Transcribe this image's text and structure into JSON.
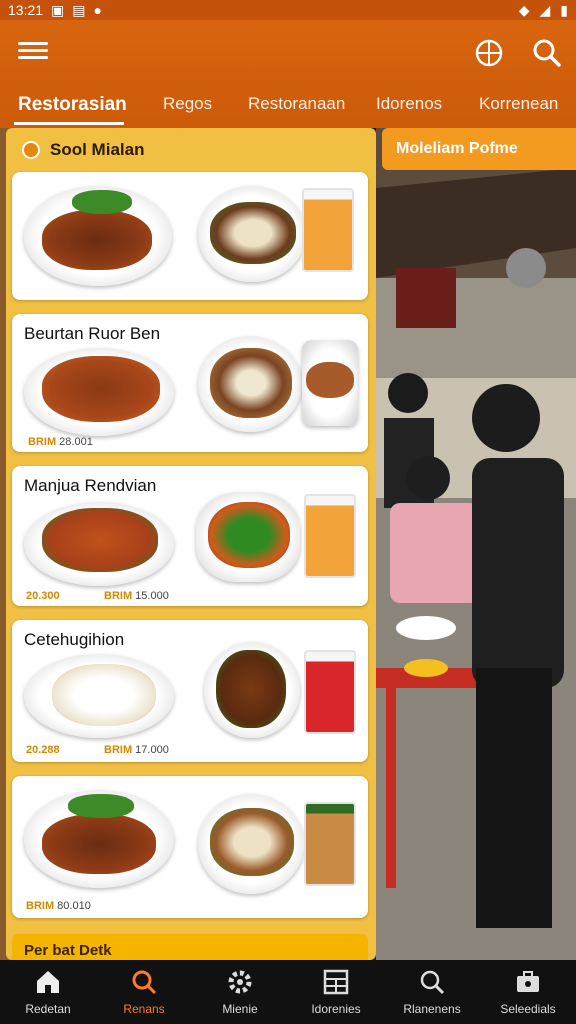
{
  "status_bar": {
    "time": "13:21"
  },
  "app_bar": {
    "tabs": [
      "Restorasian",
      "Regos",
      "Restoranaan",
      "Idorenos",
      "Korrenean"
    ],
    "active_tab": 0
  },
  "left_panel": {
    "header": "Sool Mialan",
    "cards": [
      {
        "title": "",
        "price_left_code": "",
        "price_left_value": "",
        "price_right_code": "",
        "price_right_value": ""
      },
      {
        "title": "Beurtan Ruor Ben",
        "price_left_code": "BRIM",
        "price_left_value": "28.001",
        "price_right_code": "",
        "price_right_value": ""
      },
      {
        "title": "Manjua Rendvian",
        "price_left_code": "20.300",
        "price_left_value": "",
        "price_right_code": "BRIM",
        "price_right_value": "15.000"
      },
      {
        "title": "Cetehugihion",
        "price_left_code": "20.288",
        "price_left_value": "",
        "price_right_code": "BRIM",
        "price_right_value": "17.000"
      },
      {
        "title": "",
        "price_left_code": "BRIM",
        "price_left_value": "80.010",
        "price_right_code": "",
        "price_right_value": ""
      }
    ],
    "bottom_label": "Per bat Detk"
  },
  "right_panel": {
    "header": "Moleliam Pofme"
  },
  "bottom_nav": [
    {
      "label": "Redetan",
      "icon": "home-icon"
    },
    {
      "label": "Renans",
      "icon": "search-icon"
    },
    {
      "label": "Mienie",
      "icon": "gear-icon"
    },
    {
      "label": "Idorenies",
      "icon": "grid-icon"
    },
    {
      "label": "Rlanenens",
      "icon": "search-icon"
    },
    {
      "label": "Seleedials",
      "icon": "briefcase-icon"
    }
  ],
  "colors": {
    "brand": "#cc5a08",
    "accent": "#f39b21",
    "panel": "#f1c043",
    "nav_active": "#ff7a2a"
  }
}
